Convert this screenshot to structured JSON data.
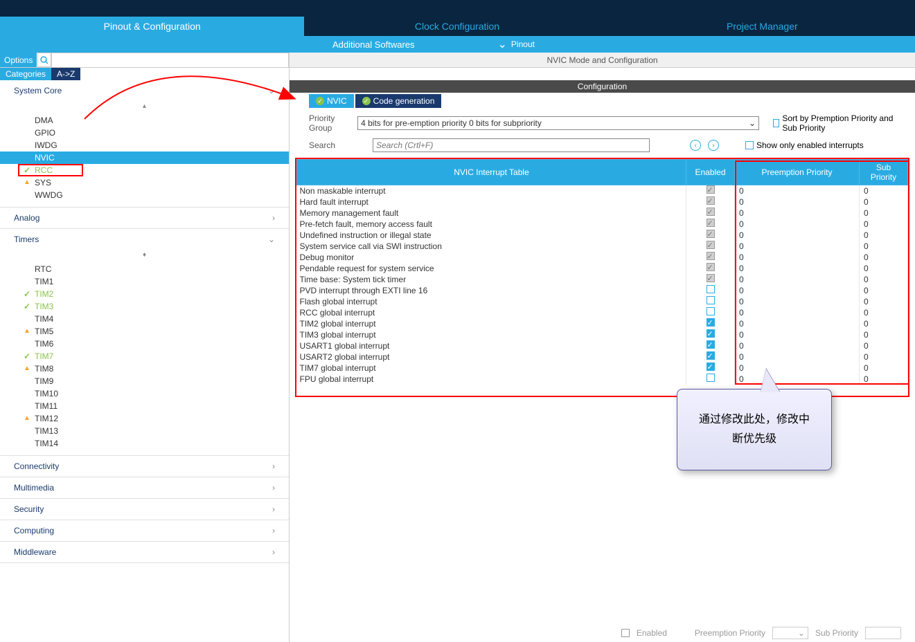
{
  "mainTabs": {
    "pinout": "Pinout & Configuration",
    "clock": "Clock Configuration",
    "project": "Project Manager"
  },
  "subBar": {
    "additional": "Additional Softwares",
    "pinout": "Pinout"
  },
  "leftHeader": {
    "options": "Options"
  },
  "catTabs": {
    "categories": "Categories",
    "alpha": "A->Z"
  },
  "sections": {
    "systemCore": {
      "label": "System Core",
      "items": [
        "DMA",
        "GPIO",
        "IWDG",
        "NVIC",
        "RCC",
        "SYS",
        "WWDG"
      ]
    },
    "analog": {
      "label": "Analog"
    },
    "timers": {
      "label": "Timers",
      "items": [
        "RTC",
        "TIM1",
        "TIM2",
        "TIM3",
        "TIM4",
        "TIM5",
        "TIM6",
        "TIM7",
        "TIM8",
        "TIM9",
        "TIM10",
        "TIM11",
        "TIM12",
        "TIM13",
        "TIM14"
      ]
    },
    "connectivity": {
      "label": "Connectivity"
    },
    "multimedia": {
      "label": "Multimedia"
    },
    "security": {
      "label": "Security"
    },
    "computing": {
      "label": "Computing"
    },
    "middleware": {
      "label": "Middleware"
    }
  },
  "modeHeader": "NVIC Mode and Configuration",
  "configHeader": "Configuration",
  "cfgTabs": {
    "nvic": "NVIC",
    "codegen": "Code generation"
  },
  "priorityGroup": {
    "label": "Priority Group",
    "value": "4 bits for pre-emption priority 0 bits for subpriority"
  },
  "sortCheck": "Sort by Premption Priority and Sub Priority",
  "searchLabel": "Search",
  "searchPlaceholder": "Search (Crtl+F)",
  "showOnly": "Show only enabled interrupts",
  "tableHeaders": {
    "name": "NVIC Interrupt Table",
    "enabled": "Enabled",
    "pre": "Preemption Priority",
    "sub": "Sub Priority"
  },
  "rows": [
    {
      "name": "Non maskable interrupt",
      "en": "gc",
      "p": "0",
      "s": "0"
    },
    {
      "name": "Hard fault interrupt",
      "en": "gc",
      "p": "0",
      "s": "0"
    },
    {
      "name": "Memory management fault",
      "en": "gc",
      "p": "0",
      "s": "0"
    },
    {
      "name": "Pre-fetch fault, memory access fault",
      "en": "gc",
      "p": "0",
      "s": "0"
    },
    {
      "name": "Undefined instruction or illegal state",
      "en": "gc",
      "p": "0",
      "s": "0"
    },
    {
      "name": "System service call via SWI instruction",
      "en": "gc",
      "p": "0",
      "s": "0"
    },
    {
      "name": "Debug monitor",
      "en": "gc",
      "p": "0",
      "s": "0"
    },
    {
      "name": "Pendable request for system service",
      "en": "gc",
      "p": "0",
      "s": "0"
    },
    {
      "name": "Time base: System tick timer",
      "en": "gc",
      "p": "0",
      "s": "0"
    },
    {
      "name": "PVD interrupt through EXTI line 16",
      "en": "u",
      "p": "0",
      "s": "0"
    },
    {
      "name": "Flash global interrupt",
      "en": "u",
      "p": "0",
      "s": "0"
    },
    {
      "name": "RCC global interrupt",
      "en": "u",
      "p": "0",
      "s": "0"
    },
    {
      "name": "TIM2 global interrupt",
      "en": "c",
      "p": "0",
      "s": "0"
    },
    {
      "name": "TIM3 global interrupt",
      "en": "c",
      "p": "0",
      "s": "0"
    },
    {
      "name": "USART1 global interrupt",
      "en": "c",
      "p": "0",
      "s": "0"
    },
    {
      "name": "USART2 global interrupt",
      "en": "c",
      "p": "0",
      "s": "0"
    },
    {
      "name": "TIM7 global interrupt",
      "en": "c",
      "p": "0",
      "s": "0"
    },
    {
      "name": "FPU global interrupt",
      "en": "u",
      "p": "0",
      "s": "0"
    }
  ],
  "callout": {
    "line1": "通过修改此处，修改中",
    "line2": "断优先级"
  },
  "bottom": {
    "enabled": "Enabled",
    "pre": "Preemption Priority",
    "sub": "Sub Priority"
  }
}
